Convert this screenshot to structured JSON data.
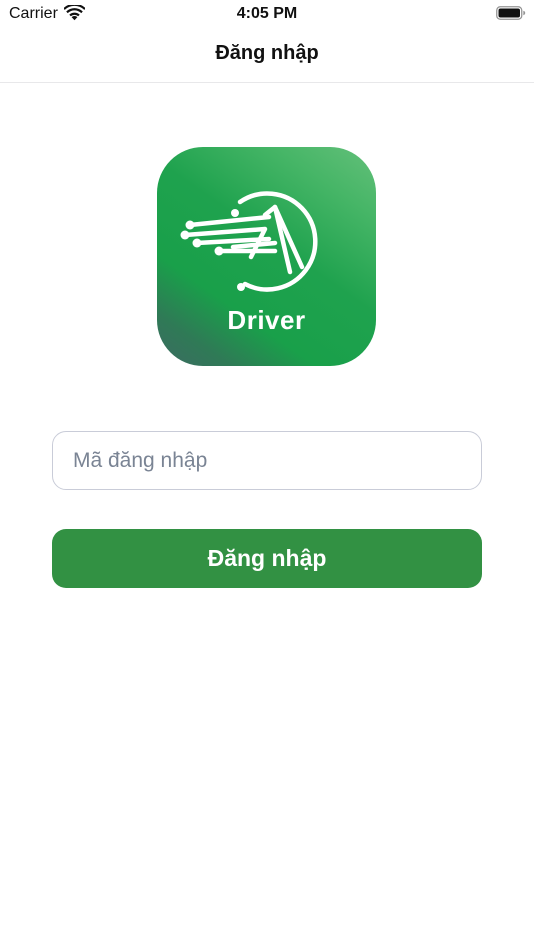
{
  "status_bar": {
    "carrier": "Carrier",
    "time": "4:05 PM",
    "wifi_icon": "wifi-icon",
    "battery_icon": "battery-icon"
  },
  "nav": {
    "title": "Đăng nhập"
  },
  "logo": {
    "text": "Driver",
    "icon": "driver-logo-icon",
    "colors": {
      "green": "#1fa24e",
      "light_green": "#64c07a",
      "dark_teal": "#3c6b62"
    }
  },
  "form": {
    "login_code_placeholder": "Mã đăng nhập",
    "login_code_value": "",
    "submit_label": "Đăng nhập"
  },
  "colors": {
    "button_bg": "#329143",
    "input_border": "#c9ccd8",
    "placeholder": "#7a8494"
  }
}
